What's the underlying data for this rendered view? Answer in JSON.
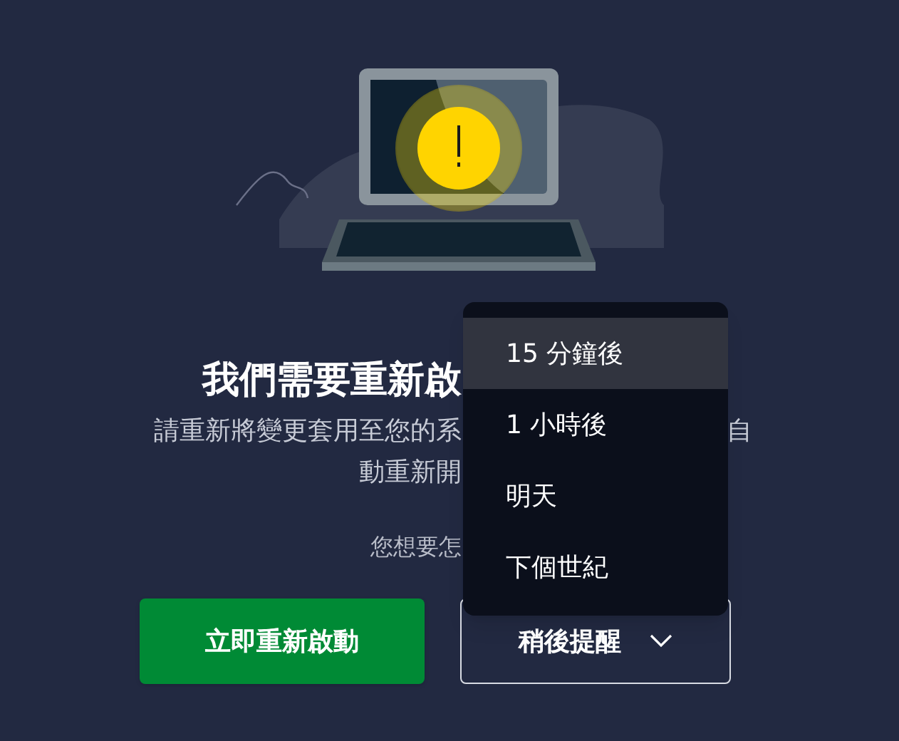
{
  "title_visible": "我們需要重新啟",
  "message_line_1": "請重新將變更套用至您的系",
  "message_line_1_end": "自",
  "message_line_2": "動重新開",
  "question": "您想要怎",
  "buttons": [
    {
      "kind": "primary",
      "label": "立即重新啟動"
    },
    {
      "kind": "dropdown",
      "label": "稍後提醒",
      "expanded": true
    }
  ],
  "menu": [
    {
      "label": "15 分鐘後",
      "selected": true
    },
    {
      "label": "1 小時後",
      "selected": false
    },
    {
      "label": "明天",
      "selected": false
    },
    {
      "label": "下個世紀",
      "selected": false
    }
  ]
}
